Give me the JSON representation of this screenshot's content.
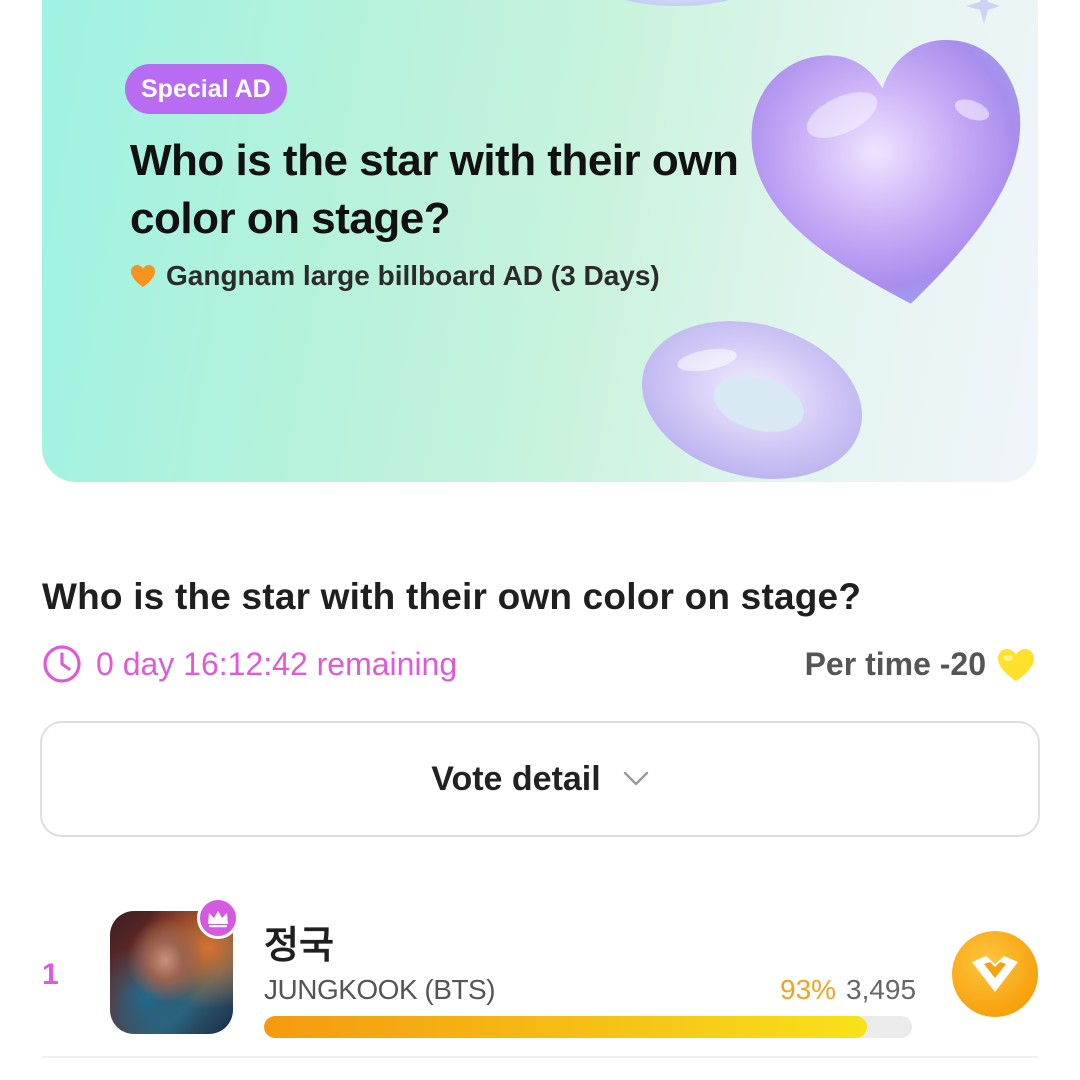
{
  "banner": {
    "badge": "Special AD",
    "title": "Who is the star with their own color on stage?",
    "subtitle": "Gangnam large billboard AD (3 Days)",
    "icons": [
      "heart-icon",
      "heart-3d-image",
      "ring-3d-image",
      "sparkle-icon"
    ]
  },
  "vote": {
    "title": "Who is the star with their own color on stage?",
    "remaining": "0 day 16:12:42 remaining",
    "per_time": "Per time -20",
    "detail_label": "Vote detail"
  },
  "colors": {
    "accent_pink": "#e05ad8",
    "badge_purple": "#b86cf2",
    "gold": "#f7a20f"
  },
  "ranking": [
    {
      "rank": "1",
      "name_ko": "정국",
      "name_en": "JUNGKOOK (BTS)",
      "percent": "93%",
      "votes": "3,495",
      "progress": 0.93
    }
  ]
}
